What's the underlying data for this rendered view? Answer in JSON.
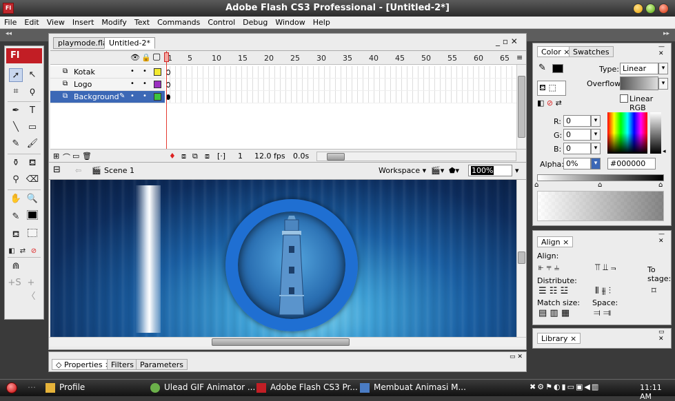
{
  "window": {
    "title": "Adobe Flash CS3 Professional - [Untitled-2*]",
    "app_icon_text": "Fl"
  },
  "menu": [
    "File",
    "Edit",
    "View",
    "Insert",
    "Modify",
    "Text",
    "Commands",
    "Control",
    "Debug",
    "Window",
    "Help"
  ],
  "tools": {
    "logo_text": "Fl"
  },
  "document": {
    "tabs": [
      "playmode.fla*",
      "Untitled-2*"
    ],
    "window_controls": "_ ▫ ✕"
  },
  "timeline": {
    "frame_numbers": [
      "1",
      "5",
      "10",
      "15",
      "20",
      "25",
      "30",
      "35",
      "40",
      "45",
      "50",
      "55",
      "60",
      "65"
    ],
    "layers": [
      {
        "name": "Kotak",
        "color": "#f3ea2f"
      },
      {
        "name": "Logo",
        "color": "#9b2fc0"
      },
      {
        "name": "Background",
        "color": "#3ec43e"
      }
    ],
    "current_frame": "1",
    "fps": "12.0 fps",
    "time": "0.0s"
  },
  "editbar": {
    "scene": "Scene 1",
    "workspace": "Workspace ▾",
    "zoom": "100%"
  },
  "properties": {
    "tabs": [
      "Properties",
      "Filters",
      "Parameters"
    ]
  },
  "color_panel": {
    "tabs": [
      "Color",
      "Swatches"
    ],
    "type_label": "Type:",
    "type_value": "Linear",
    "overflow_label": "Overflow:",
    "linear_rgb_label": "Linear RGB",
    "r_label": "R:",
    "r_value": "0",
    "g_label": "G:",
    "g_value": "0",
    "b_label": "B:",
    "b_value": "0",
    "alpha_label": "Alpha:",
    "alpha_value": "0%",
    "hex_value": "#000000"
  },
  "align_panel": {
    "tab": "Align",
    "align_label": "Align:",
    "distribute_label": "Distribute:",
    "match_size_label": "Match size:",
    "space_label": "Space:",
    "to_stage_label": "To stage:"
  },
  "library_panel": {
    "tab": "Library"
  },
  "taskbar": {
    "items": [
      "Profile",
      "Ulead GIF Animator ...",
      "Adobe Flash CS3 Pr...",
      "Membuat Animasi M..."
    ],
    "clock": "11:11 AM"
  }
}
